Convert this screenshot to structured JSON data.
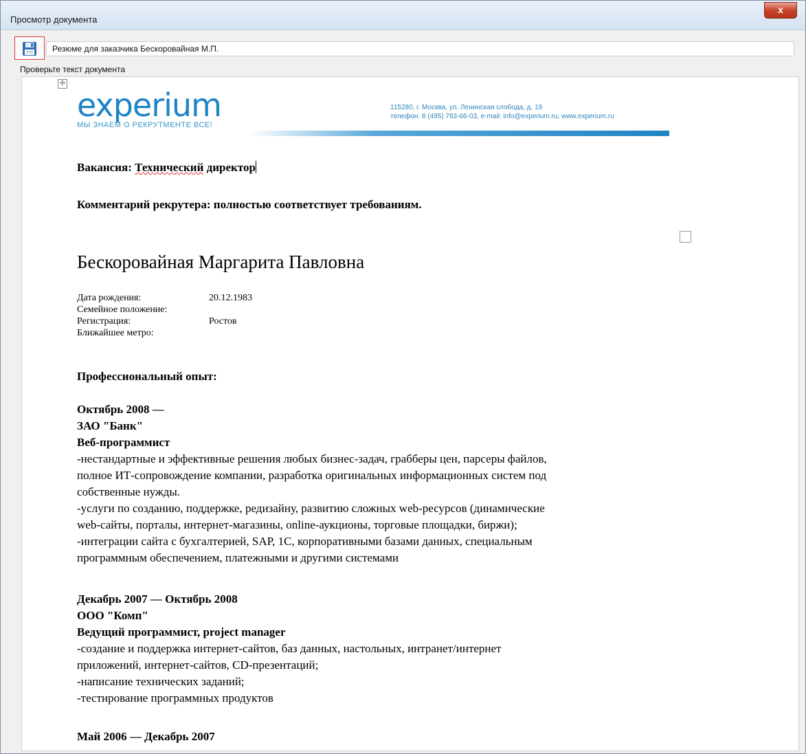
{
  "window": {
    "title": "Просмотр документа",
    "close_label": "x"
  },
  "toolbar": {
    "document_name": "Резюме для заказчика Бескоровайная М.П."
  },
  "hint": "Проверьте текст документа",
  "document": {
    "logo": {
      "text_part1": "e",
      "text_x": "x",
      "text_part2": "perium",
      "slogan": "МЫ ЗНАЕМ О РЕКРУТМЕНТЕ ВСЕ!"
    },
    "company_address": "115280, г. Москва, ул. Ленинская слобода, д. 19",
    "company_contacts": "телефон: 8 (495) 783-66-03, e-mail: info@experium.ru, www.experium.ru",
    "vacancy_label": "Вакансия:",
    "vacancy_word1": "Технический",
    "vacancy_word2": "директор",
    "comment": "Комментарий рекрутера: полностью соответствует требованиям.",
    "person_name": "Бескоровайная Маргарита Павловна",
    "facts": [
      {
        "label": "Дата рождения:",
        "value": "20.12.1983"
      },
      {
        "label": "Семейное положение:",
        "value": ""
      },
      {
        "label": "Регистрация:",
        "value": "Ростов"
      },
      {
        "label": "Ближайшее метро:",
        "value": ""
      }
    ],
    "experience_title": "Профессиональный опыт:",
    "jobs": [
      {
        "period": "Октябрь 2008 —",
        "company": "ЗАО \"Банк\"",
        "position": "Веб-программист",
        "lines": [
          "-нестандартные и эффективные решения любых бизнес-задач, грабберы цен, парсеры файлов,",
          "полное ИТ-сопровождение компании, разработка оригинальных информационных систем под",
          "собственные нужды.",
          "-услуги по созданию, поддержке, редизайну, развитию сложных web-ресурсов (динамические",
          "web-сайты, порталы, интернет-магазины, online-аукционы, торговые площадки, биржи);",
          "-интеграции сайта с бухгалтерией, SAP, 1С, корпоративными базами данных, специальным",
          "программным обеспечением, платежными и другими системами"
        ]
      },
      {
        "period": "Декабрь 2007 — Октябрь 2008",
        "company": "ООО \"Комп\"",
        "position": "Ведущий программист, project manager",
        "lines": [
          "-создание и поддержка интернет-сайтов, баз данных, настольных, интранет/интернет",
          "приложений, интернет-сайтов, CD-презентаций;",
          "-написание технических заданий;",
          "-тестирование программных продуктов"
        ]
      },
      {
        "period": "Май 2006 — Декабрь 2007"
      }
    ]
  }
}
